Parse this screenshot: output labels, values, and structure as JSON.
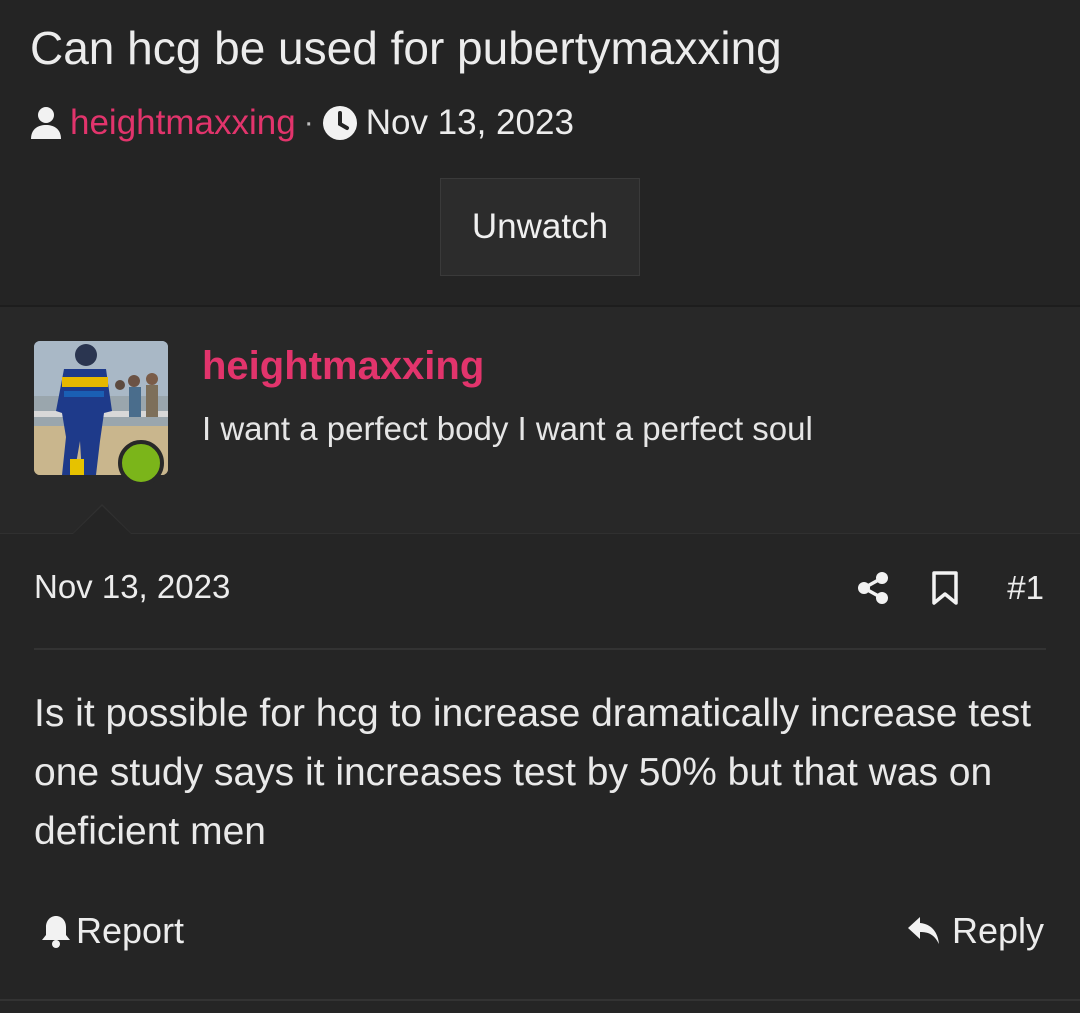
{
  "thread": {
    "title": "Can hcg be used for pubertymaxxing",
    "author": "heightmaxxing",
    "separator": "·",
    "date": "Nov 13, 2023",
    "watch_label": "Unwatch"
  },
  "post": {
    "username": "heightmaxxing",
    "user_title": "I want a perfect body I want a perfect soul",
    "online": true,
    "date": "Nov 13, 2023",
    "number": "#1",
    "body": "Is it possible for hcg to increase dramatically increase test one study says it increases test by 50% but that was on deficient men",
    "report_label": "Report",
    "reply_label": "Reply"
  },
  "icons": {
    "author": "user-icon",
    "date": "clock-icon",
    "share": "share-icon",
    "bookmark": "bookmark-icon",
    "report": "bell-icon",
    "reply": "reply-icon"
  },
  "colors": {
    "accent": "#e2346c",
    "online": "#7bb51a",
    "background": "#252525"
  }
}
